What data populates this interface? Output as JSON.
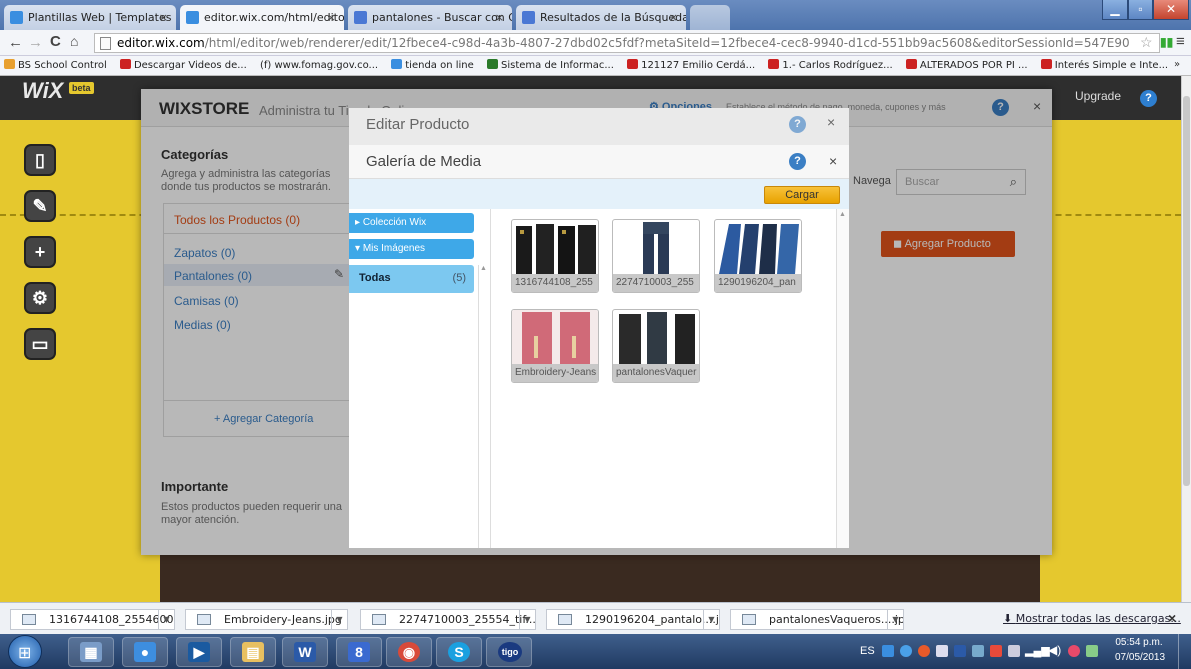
{
  "browser": {
    "tabs": [
      {
        "label": "Plantillas Web | Templates",
        "color": "#3a8ee0"
      },
      {
        "label": "editor.wix.com/html/edito",
        "color": "#3a8ee0"
      },
      {
        "label": "pantalones - Buscar con G",
        "color": "#4a78d4"
      },
      {
        "label": "Resultados de la Búsqueda",
        "color": "#4a78d4"
      }
    ],
    "url_host": "editor.wix.com",
    "url_path": "/html/editor/web/renderer/edit/12fbece4-c98d-4a3b-4807-27dbd02c5fdf?metaSiteId=12fbece4-cec8-9940-d1cd-551bb9ac5608&editorSessionId=547E90",
    "bookmarks": [
      {
        "label": "BS School Control",
        "color": "#e8a030"
      },
      {
        "label": "Descargar Videos de...",
        "color": "#cc2222"
      },
      {
        "label": "(f) www.fomag.gov.co...",
        "color": "#ffffff"
      },
      {
        "label": "tienda on line",
        "color": "#3a8ee0"
      },
      {
        "label": "Sistema de Informac...",
        "color": "#2a7a2a"
      },
      {
        "label": "121127 Emilio Cerdá...",
        "color": "#cc2222"
      },
      {
        "label": "1.- Carlos Rodríguez...",
        "color": "#cc2222"
      },
      {
        "label": "ALTERADOS POR PI ...",
        "color": "#cc2222"
      },
      {
        "label": "Interés Simple e Inte...",
        "color": "#cc2222"
      }
    ],
    "bookmarks_more": "»"
  },
  "wix": {
    "logo": "WiX",
    "logo_badge": "beta",
    "upgrade": "Upgrade",
    "help": "?"
  },
  "store": {
    "brand": "WIXSTORE",
    "subtitle": "Administra tu Tienda Online",
    "options": "Opciones",
    "options_desc": "Establece el método de pago, moneda, cupones y más",
    "help": "?",
    "close": "×",
    "categories_title": "Categorías",
    "categories_desc_1": "Agrega y administra las categorías",
    "categories_desc_2": "donde tus productos se mostrarán.",
    "all_products": "Todos los Productos (0)",
    "categories": [
      {
        "label": "Zapatos (0)"
      },
      {
        "label": "Pantalones (0)"
      },
      {
        "label": "Camisas (0)"
      },
      {
        "label": "Medias (0)"
      }
    ],
    "add_category": "+ Agregar Categoría",
    "important_title": "Importante",
    "important_desc_1": "Estos productos pueden requerir una",
    "important_desc_2": "mayor atención.",
    "navigate": "Navega",
    "search_placeholder": "Buscar",
    "add_product": "Agregar Producto"
  },
  "edit_dialog": {
    "title": "Editar Producto",
    "help": "?",
    "close": "×"
  },
  "media_dialog": {
    "title": "Galería de Media",
    "help": "?",
    "close": "×",
    "upload": "Cargar",
    "nav": [
      {
        "label": "Colección Wix",
        "arrow": "▸"
      },
      {
        "label": "Mis Imágenes",
        "arrow": "▾"
      }
    ],
    "selected_folder": {
      "label": "Todas",
      "count": "(5)"
    },
    "images": [
      {
        "caption": "1316744108_255",
        "palette": [
          "#1a1a1a",
          "#2a2a2a",
          "#141414",
          "#202020"
        ]
      },
      {
        "caption": "2274710003_255",
        "palette": [
          "#2a3a55"
        ]
      },
      {
        "caption": "1290196204_pan",
        "palette": [
          "#2c5aa0",
          "#24406e",
          "#1e2e48",
          "#3466a8"
        ]
      },
      {
        "caption": "Embroidery-Jeans",
        "palette": [
          "#d06a78"
        ]
      },
      {
        "caption": "pantalonesVaquer",
        "palette": [
          "#2a2a2a",
          "#303a44",
          "#222"
        ]
      }
    ]
  },
  "downloads": {
    "items": [
      {
        "label": "1316744108_2554600....jpg"
      },
      {
        "label": "Embroidery-Jeans.jpg"
      },
      {
        "label": "2274710003_25554_tif....jpg"
      },
      {
        "label": "1290196204_pantalo....jpg"
      },
      {
        "label": "pantalonesVaqueros....jpg"
      }
    ],
    "show_all": "Mostrar todas las descargas...",
    "close": "×"
  },
  "taskbar": {
    "apps": [
      {
        "name": "calculator",
        "glyph": "▦",
        "color": "#7a9cc8"
      },
      {
        "name": "messenger",
        "glyph": "●",
        "color": "#3d8ee0"
      },
      {
        "name": "media-player",
        "glyph": "▶",
        "color": "#1a5aa0"
      },
      {
        "name": "explorer",
        "glyph": "▤",
        "color": "#e8c060"
      },
      {
        "name": "word",
        "glyph": "W",
        "color": "#2b5aa8"
      },
      {
        "name": "google",
        "glyph": "8",
        "color": "#3a6ad0"
      },
      {
        "name": "chrome",
        "glyph": "◉",
        "color": "#d84a3a"
      },
      {
        "name": "skype",
        "glyph": "S",
        "color": "#1aa0e0"
      },
      {
        "name": "tigo",
        "glyph": "tigo",
        "color": "#1a3a80"
      }
    ],
    "lang": "ES",
    "time": "05:54 p.m.",
    "date": "07/05/2013"
  }
}
